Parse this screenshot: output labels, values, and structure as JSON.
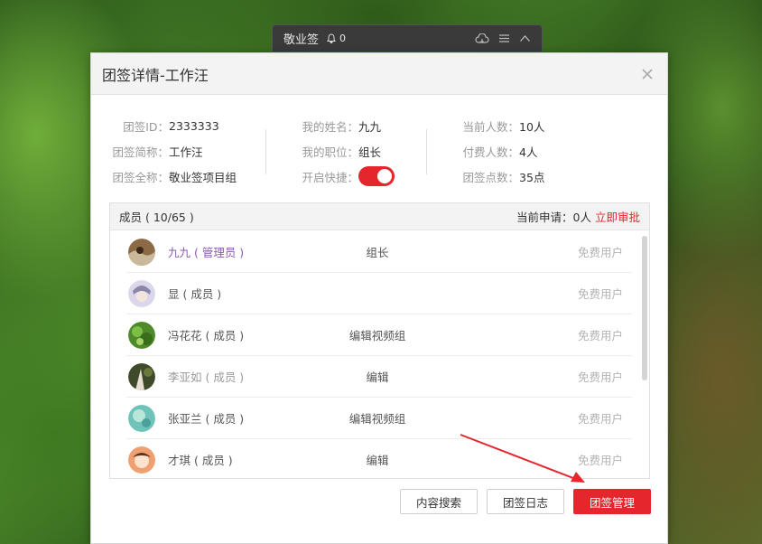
{
  "minibar": {
    "title": "敬业签",
    "bell_count": "0"
  },
  "dialog": {
    "title": "团签详情-工作汪",
    "info": {
      "col1": [
        {
          "label": "团签ID：",
          "value": "2333333"
        },
        {
          "label": "团签简称：",
          "value": "工作汪"
        },
        {
          "label": "团签全称：",
          "value": "敬业签项目组"
        }
      ],
      "col2": [
        {
          "label": "我的姓名：",
          "value": "九九"
        },
        {
          "label": "我的职位：",
          "value": "组长"
        },
        {
          "label": "开启快捷：",
          "value": ""
        }
      ],
      "col3": [
        {
          "label": "当前人数：",
          "value": "10人"
        },
        {
          "label": "付费人数：",
          "value": "4人"
        },
        {
          "label": "团签点数：",
          "value": "35点"
        }
      ],
      "shortcut_enabled": true
    },
    "members": {
      "title": "成员 ( 10/65 )",
      "pending_label": "当前申请：",
      "pending_count": "0人",
      "approve_label": "立即审批",
      "rows": [
        {
          "name": "九九 ( 管理员 )",
          "role": "组长",
          "type": "免费用户",
          "avatar": "avatar-1"
        },
        {
          "name": "显 ( 成员 )",
          "role": "",
          "type": "免费用户",
          "avatar": "avatar-2"
        },
        {
          "name": "冯花花 ( 成员 )",
          "role": "编辑视频组",
          "type": "免费用户",
          "avatar": "avatar-3"
        },
        {
          "name": "李亚如 ( 成员 )",
          "role": "编辑",
          "type": "免费用户",
          "avatar": "avatar-4"
        },
        {
          "name": "张亚兰 ( 成员 )",
          "role": "编辑视频组",
          "type": "免费用户",
          "avatar": "avatar-5"
        },
        {
          "name": "才琪 ( 成员 )",
          "role": "编辑",
          "type": "免费用户",
          "avatar": "avatar-6"
        }
      ]
    },
    "buttons": {
      "search": "内容搜索",
      "log": "团签日志",
      "manage": "团签管理"
    }
  },
  "colors": {
    "accent": "#e5262c",
    "admin": "#8a5bb0"
  }
}
